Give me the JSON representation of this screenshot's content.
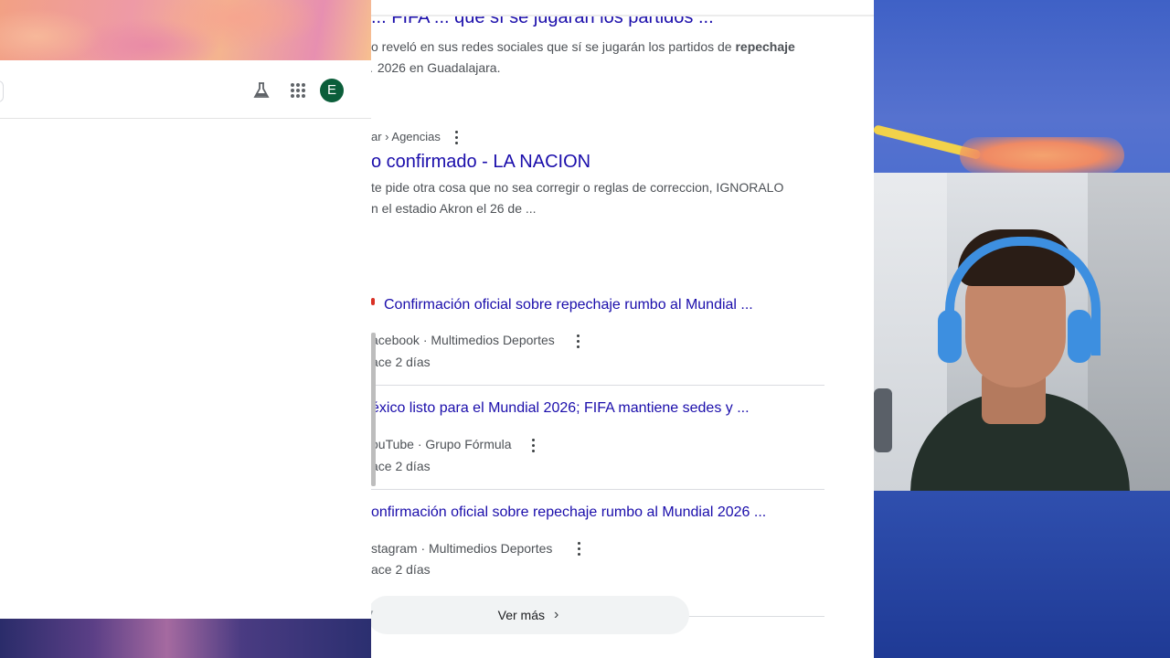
{
  "left_window": {
    "avatar_letter": "E",
    "labs_icon": "labs-flask-icon",
    "apps_icon": "apps-grid-icon"
  },
  "results": {
    "cut_title": "... FIFA ... que sí se jugarán los partidos ...",
    "snippet1_a": "o reveló en sus redes sociales que sí se jugarán los partidos de ",
    "snippet1_bold": "repechaje",
    "snippet1_b": "2026 en Guadalajara.",
    "breadcrumb2": "ar › Agencias",
    "title2": "o confirmado - LA NACION",
    "snippet2_a": "te pide otra cosa que no sea corregir o reglas de correccion, IGNORALO",
    "snippet2_b": "n el estadio Akron el 26 de ...",
    "videos": [
      {
        "title": "Confirmación oficial sobre repechaje rumbo al Mundial ...",
        "source": "acebook · Multimedios Deportes",
        "date": "ace 2 días"
      },
      {
        "title": "éxico listo para el Mundial 2026; FIFA mantiene sedes y ...",
        "source": "ouTube · Grupo Fórmula",
        "date": "ace 2 días"
      },
      {
        "title": "onfirmación oficial sobre repechaje rumbo al Mundial 2026 ...",
        "source": "stagram · Multimedios Deportes",
        "date": "ace 2 días"
      }
    ],
    "more_label": "Ver más",
    "more_chevron": "›"
  },
  "colors": {
    "link": "#1a0dab",
    "text": "#4d5156",
    "avatar": "#0b5e3a"
  }
}
